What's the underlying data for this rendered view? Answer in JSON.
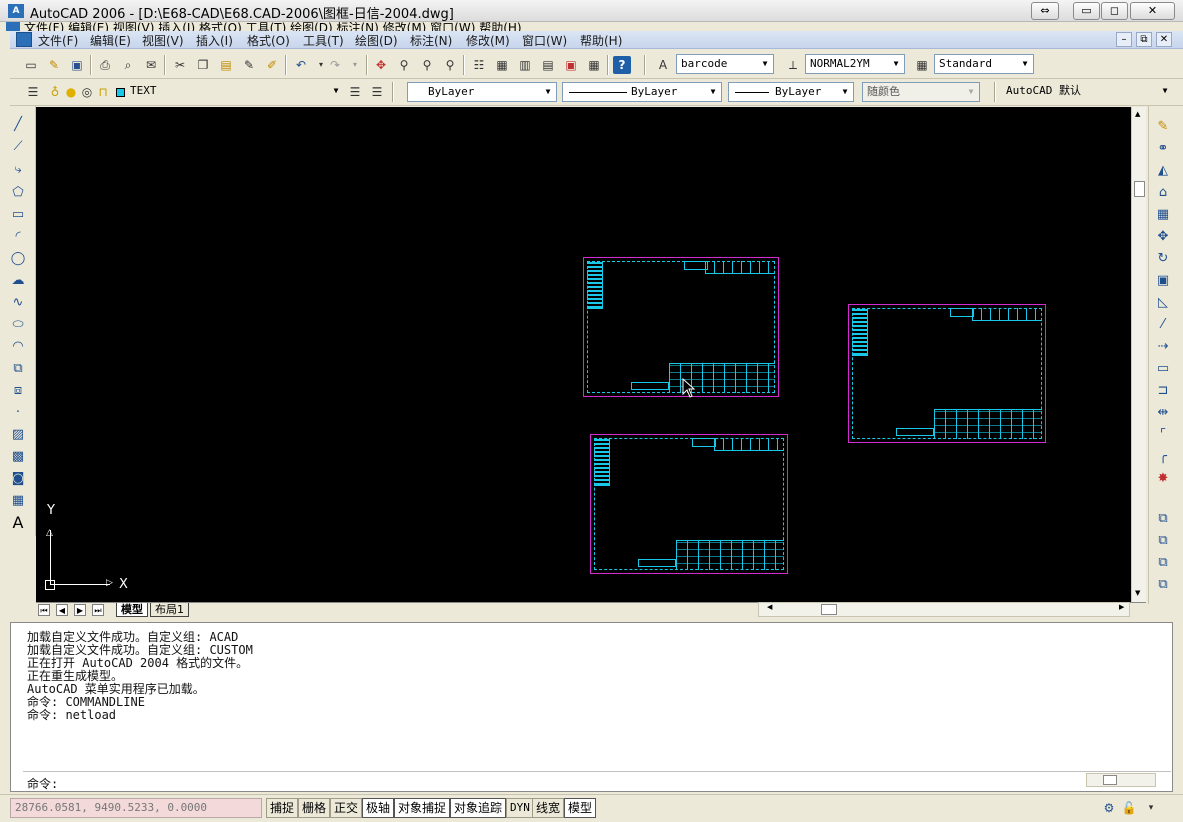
{
  "window": {
    "title": "AutoCAD 2006 - [D:\\E68-CAD\\E68.CAD-2006\\图框-日信-2004.dwg]",
    "app_icon": "autocad-logo-icon",
    "controls": [
      "⇔",
      "▭",
      "◻",
      "✕"
    ]
  },
  "menu_clipped": "文件(F)   编辑(E)   视图(V)   插入(I)   格式(O)   工具(T)   绘图(D)   标注(N)   修改(M)   窗口(W)   帮助(H)",
  "menu": {
    "items": [
      "文件(F)",
      "编辑(E)",
      "视图(V)",
      "插入(I)",
      "格式(O)",
      "工具(T)",
      "绘图(D)",
      "标注(N)",
      "修改(M)",
      "窗口(W)",
      "帮助(H)"
    ],
    "mdi_controls": [
      "–",
      "⧉",
      "✕"
    ]
  },
  "toolbar_standard": {
    "text_style": "barcode",
    "dim_style": "NORMAL2YM",
    "table_style": "Standard"
  },
  "toolbar_layers": {
    "current_layer": "TEXT",
    "color": "ByLayer",
    "linetype": "ByLayer",
    "lineweight": "ByLayer",
    "plot_style": "随颜色",
    "workspace": "AutoCAD 默认"
  },
  "canvas": {
    "background": "#000000",
    "ucs_x": "X",
    "ucs_y": "Y"
  },
  "layout_tabs": [
    "模型",
    "布局1"
  ],
  "command": {
    "history": "加载自定义文件成功。自定义组: ACAD\n加载自定义文件成功。自定义组: CUSTOM\n正在打开 AutoCAD 2004 格式的文件。\n正在重生成模型。\nAutoCAD 菜单实用程序已加载。\n命令: COMMANDLINE\n命令: netload",
    "prompt": "命令:"
  },
  "status": {
    "coordinates": "28766.0581, 9490.5233, 0.0000",
    "buttons": [
      {
        "label": "捕捉",
        "on": false
      },
      {
        "label": "栅格",
        "on": false
      },
      {
        "label": "正交",
        "on": false
      },
      {
        "label": "极轴",
        "on": true
      },
      {
        "label": "对象捕捉",
        "on": true
      },
      {
        "label": "对象追踪",
        "on": true
      },
      {
        "label": "DYN",
        "on": false
      },
      {
        "label": "线宽",
        "on": false
      },
      {
        "label": "模型",
        "on": true
      }
    ]
  }
}
